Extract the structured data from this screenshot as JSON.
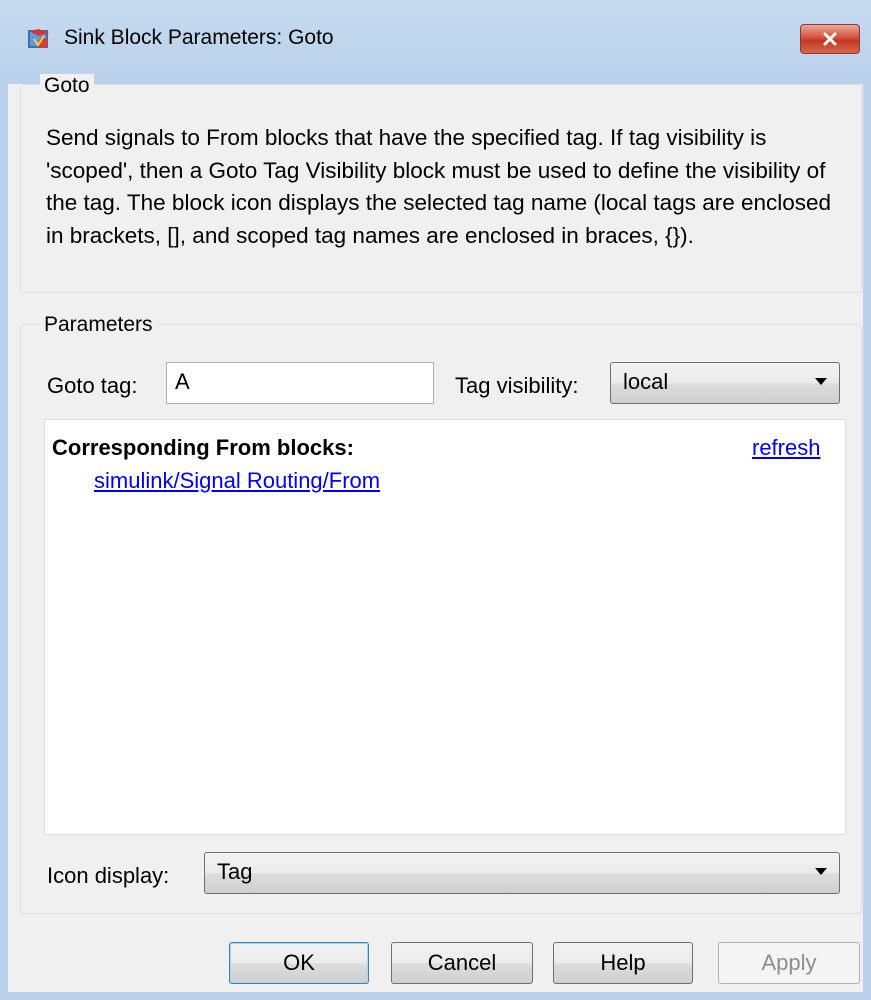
{
  "window": {
    "title": "Sink Block Parameters: Goto",
    "close_label": "✕"
  },
  "goto_group": {
    "label": "Goto",
    "description": "Send signals to From blocks that have the specified tag.  If tag visibility is 'scoped', then a Goto Tag Visibility block must be used to define the visibility of the tag.  The block icon displays the selected tag name (local tags are enclosed in brackets, [], and scoped tag names are enclosed in braces, {})."
  },
  "parameters": {
    "label": "Parameters",
    "goto_tag_label": "Goto tag:",
    "goto_tag_value": "A",
    "tag_visibility_label": "Tag visibility:",
    "tag_visibility_value": "local",
    "corresponding_heading": "Corresponding From blocks:",
    "refresh_label": "refresh",
    "from_blocks": [
      "simulink/Signal Routing/From"
    ],
    "icon_display_label": "Icon display:",
    "icon_display_value": "Tag"
  },
  "buttons": {
    "ok": "OK",
    "cancel": "Cancel",
    "help": "Help",
    "apply": "Apply"
  },
  "colors": {
    "link": "#0000ee",
    "close_button": "#c9452c",
    "title_gradient": "#b9d1ea"
  }
}
